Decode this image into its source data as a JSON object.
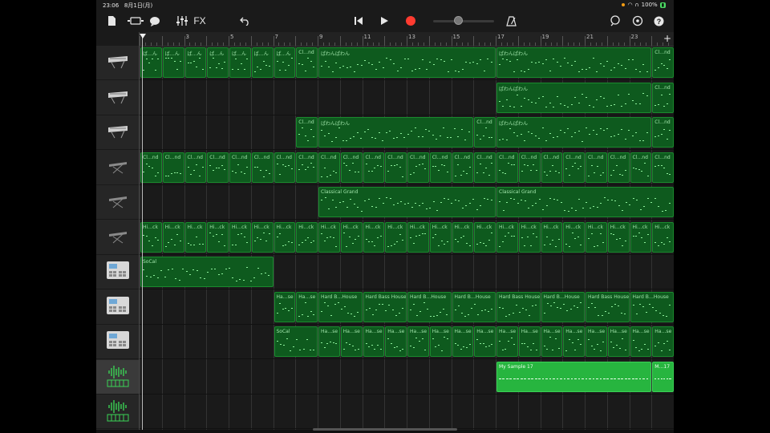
{
  "status": {
    "time": "23:06",
    "date": "8月1日(月)",
    "battery": "100%"
  },
  "toolbar": {
    "fx_label": "FX",
    "add_label": "+"
  },
  "colors": {
    "midi_region": "#0e5a1e",
    "audio_region": "#27b53f",
    "record": "#ff3b30"
  },
  "ruler": {
    "bars": [
      "3",
      "5",
      "7",
      "9",
      "11",
      "13",
      "15",
      "17",
      "19",
      "21",
      "23"
    ]
  },
  "tracks": [
    {
      "icon": "synth-keyboard-icon",
      "selected": false
    },
    {
      "icon": "synth-keyboard-icon",
      "selected": false
    },
    {
      "icon": "synth-keyboard-icon",
      "selected": false
    },
    {
      "icon": "keyboard-stand-icon",
      "selected": false
    },
    {
      "icon": "keyboard-stand-icon",
      "selected": false
    },
    {
      "icon": "keyboard-stand-icon",
      "selected": false
    },
    {
      "icon": "drum-machine-icon",
      "selected": false
    },
    {
      "icon": "drum-machine-icon",
      "selected": false
    },
    {
      "icon": "drum-machine-icon",
      "selected": false
    },
    {
      "icon": "audio-recorder-icon",
      "selected": true
    },
    {
      "icon": "audio-recorder-icon",
      "selected": false
    }
  ],
  "regions": [
    {
      "track": 0,
      "start": 1,
      "len": 1,
      "label": "ば…ん"
    },
    {
      "track": 0,
      "start": 2,
      "len": 1,
      "label": "ば…ん"
    },
    {
      "track": 0,
      "start": 3,
      "len": 1,
      "label": "ば…ん"
    },
    {
      "track": 0,
      "start": 4,
      "len": 1,
      "label": "ば…ん"
    },
    {
      "track": 0,
      "start": 5,
      "len": 1,
      "label": "ば…ん"
    },
    {
      "track": 0,
      "start": 6,
      "len": 1,
      "label": "ば…ん"
    },
    {
      "track": 0,
      "start": 7,
      "len": 1,
      "label": "ば…ん"
    },
    {
      "track": 0,
      "start": 8,
      "len": 1,
      "label": "Cl…nd"
    },
    {
      "track": 0,
      "start": 9,
      "len": 8,
      "label": "ぱわんぱわん"
    },
    {
      "track": 0,
      "start": 17,
      "len": 7,
      "label": "ぱわんぱわん"
    },
    {
      "track": 0,
      "start": 24,
      "len": 1,
      "label": "Cl…nd"
    },
    {
      "track": 1,
      "start": 17,
      "len": 7,
      "label": "ぱわんぱわん"
    },
    {
      "track": 1,
      "start": 24,
      "len": 1,
      "label": "Cl…nd"
    },
    {
      "track": 2,
      "start": 8,
      "len": 1,
      "label": "Cl…nd"
    },
    {
      "track": 2,
      "start": 9,
      "len": 7,
      "label": "ぱわんぱわん"
    },
    {
      "track": 2,
      "start": 16,
      "len": 1,
      "label": "Cl…nd"
    },
    {
      "track": 2,
      "start": 17,
      "len": 7,
      "label": "ぱわんぱわん"
    },
    {
      "track": 2,
      "start": 24,
      "len": 1,
      "label": "Cl…nd"
    },
    {
      "track": 3,
      "start": 1,
      "len": 1,
      "label": "Cl…nd"
    },
    {
      "track": 3,
      "start": 2,
      "len": 1,
      "label": "Cl…nd"
    },
    {
      "track": 3,
      "start": 3,
      "len": 1,
      "label": "Cl…nd"
    },
    {
      "track": 3,
      "start": 4,
      "len": 1,
      "label": "Cl…nd"
    },
    {
      "track": 3,
      "start": 5,
      "len": 1,
      "label": "Cl…nd"
    },
    {
      "track": 3,
      "start": 6,
      "len": 1,
      "label": "Cl…nd"
    },
    {
      "track": 3,
      "start": 7,
      "len": 1,
      "label": "Cl…nd"
    },
    {
      "track": 3,
      "start": 8,
      "len": 1,
      "label": "Cl…nd"
    },
    {
      "track": 3,
      "start": 9,
      "len": 1,
      "label": "Cl…nd"
    },
    {
      "track": 3,
      "start": 10,
      "len": 1,
      "label": "Cl…nd"
    },
    {
      "track": 3,
      "start": 11,
      "len": 1,
      "label": "Cl…nd"
    },
    {
      "track": 3,
      "start": 12,
      "len": 1,
      "label": "Cl…nd"
    },
    {
      "track": 3,
      "start": 13,
      "len": 1,
      "label": "Cl…nd"
    },
    {
      "track": 3,
      "start": 14,
      "len": 1,
      "label": "Cl…nd"
    },
    {
      "track": 3,
      "start": 15,
      "len": 1,
      "label": "Cl…nd"
    },
    {
      "track": 3,
      "start": 16,
      "len": 1,
      "label": "Cl…nd"
    },
    {
      "track": 3,
      "start": 17,
      "len": 1,
      "label": "Cl…nd"
    },
    {
      "track": 3,
      "start": 18,
      "len": 1,
      "label": "Cl…nd"
    },
    {
      "track": 3,
      "start": 19,
      "len": 1,
      "label": "Cl…nd"
    },
    {
      "track": 3,
      "start": 20,
      "len": 1,
      "label": "Cl…nd"
    },
    {
      "track": 3,
      "start": 21,
      "len": 1,
      "label": "Cl…nd"
    },
    {
      "track": 3,
      "start": 22,
      "len": 1,
      "label": "Cl…nd"
    },
    {
      "track": 3,
      "start": 23,
      "len": 1,
      "label": "Cl…nd"
    },
    {
      "track": 3,
      "start": 24,
      "len": 1,
      "label": "Cl…nd"
    },
    {
      "track": 4,
      "start": 9,
      "len": 8,
      "label": "Classical Grand"
    },
    {
      "track": 4,
      "start": 17,
      "len": 8,
      "label": "Classical Grand"
    },
    {
      "track": 5,
      "start": 1,
      "len": 1,
      "label": "Hi…ck"
    },
    {
      "track": 5,
      "start": 2,
      "len": 1,
      "label": "Hi…ck"
    },
    {
      "track": 5,
      "start": 3,
      "len": 1,
      "label": "Hi…ck"
    },
    {
      "track": 5,
      "start": 4,
      "len": 1,
      "label": "Hi…ck"
    },
    {
      "track": 5,
      "start": 5,
      "len": 1,
      "label": "Hi…ck"
    },
    {
      "track": 5,
      "start": 6,
      "len": 1,
      "label": "Hi…ck"
    },
    {
      "track": 5,
      "start": 7,
      "len": 1,
      "label": "Hi…ck"
    },
    {
      "track": 5,
      "start": 8,
      "len": 1,
      "label": "Hi…ck"
    },
    {
      "track": 5,
      "start": 9,
      "len": 1,
      "label": "Hi…ck"
    },
    {
      "track": 5,
      "start": 10,
      "len": 1,
      "label": "Hi…ck"
    },
    {
      "track": 5,
      "start": 11,
      "len": 1,
      "label": "Hi…ck"
    },
    {
      "track": 5,
      "start": 12,
      "len": 1,
      "label": "Hi…ck"
    },
    {
      "track": 5,
      "start": 13,
      "len": 1,
      "label": "Hi…ck"
    },
    {
      "track": 5,
      "start": 14,
      "len": 1,
      "label": "Hi…ck"
    },
    {
      "track": 5,
      "start": 15,
      "len": 1,
      "label": "Hi…ck"
    },
    {
      "track": 5,
      "start": 16,
      "len": 1,
      "label": "Hi…ck"
    },
    {
      "track": 5,
      "start": 17,
      "len": 1,
      "label": "Hi…ck"
    },
    {
      "track": 5,
      "start": 18,
      "len": 1,
      "label": "Hi…ck"
    },
    {
      "track": 5,
      "start": 19,
      "len": 1,
      "label": "Hi…ck"
    },
    {
      "track": 5,
      "start": 20,
      "len": 1,
      "label": "Hi…ck"
    },
    {
      "track": 5,
      "start": 21,
      "len": 1,
      "label": "Hi…ck"
    },
    {
      "track": 5,
      "start": 22,
      "len": 1,
      "label": "Hi…ck"
    },
    {
      "track": 5,
      "start": 23,
      "len": 1,
      "label": "Hi…ck"
    },
    {
      "track": 5,
      "start": 24,
      "len": 1,
      "label": "Hi…ck"
    },
    {
      "track": 6,
      "start": 1,
      "len": 6,
      "label": "SoCal"
    },
    {
      "track": 7,
      "start": 7,
      "len": 1,
      "label": "Ha…se"
    },
    {
      "track": 7,
      "start": 8,
      "len": 1,
      "label": "Ha…se"
    },
    {
      "track": 7,
      "start": 9,
      "len": 2,
      "label": "Hard B…House"
    },
    {
      "track": 7,
      "start": 11,
      "len": 2,
      "label": "Hard Bass House"
    },
    {
      "track": 7,
      "start": 13,
      "len": 2,
      "label": "Hard B…House"
    },
    {
      "track": 7,
      "start": 15,
      "len": 2,
      "label": "Hard B…House"
    },
    {
      "track": 7,
      "start": 17,
      "len": 2,
      "label": "Hard Bass House"
    },
    {
      "track": 7,
      "start": 19,
      "len": 2,
      "label": "Hard B…House"
    },
    {
      "track": 7,
      "start": 21,
      "len": 2,
      "label": "Hard Bass House"
    },
    {
      "track": 7,
      "start": 23,
      "len": 2,
      "label": "Hard B…House"
    },
    {
      "track": 8,
      "start": 7,
      "len": 2,
      "label": "SoCal"
    },
    {
      "track": 8,
      "start": 9,
      "len": 1,
      "label": "Ha…se"
    },
    {
      "track": 8,
      "start": 10,
      "len": 1,
      "label": "Ha…se"
    },
    {
      "track": 8,
      "start": 11,
      "len": 1,
      "label": "Ha…se"
    },
    {
      "track": 8,
      "start": 12,
      "len": 1,
      "label": "Ha…se"
    },
    {
      "track": 8,
      "start": 13,
      "len": 1,
      "label": "Ha…se"
    },
    {
      "track": 8,
      "start": 14,
      "len": 1,
      "label": "Ha…se"
    },
    {
      "track": 8,
      "start": 15,
      "len": 1,
      "label": "Ha…se"
    },
    {
      "track": 8,
      "start": 16,
      "len": 1,
      "label": "Ha…se"
    },
    {
      "track": 8,
      "start": 17,
      "len": 1,
      "label": "Ha…se"
    },
    {
      "track": 8,
      "start": 18,
      "len": 1,
      "label": "Ha…se"
    },
    {
      "track": 8,
      "start": 19,
      "len": 1,
      "label": "Ha…se"
    },
    {
      "track": 8,
      "start": 20,
      "len": 1,
      "label": "Ha…se"
    },
    {
      "track": 8,
      "start": 21,
      "len": 1,
      "label": "Ha…se"
    },
    {
      "track": 8,
      "start": 22,
      "len": 1,
      "label": "Ha…se"
    },
    {
      "track": 8,
      "start": 23,
      "len": 1,
      "label": "Ha…se"
    },
    {
      "track": 8,
      "start": 24,
      "len": 1,
      "label": "Ha…se"
    },
    {
      "track": 9,
      "start": 17,
      "len": 7,
      "label": "My Sample 17",
      "audio": true
    },
    {
      "track": 9,
      "start": 24,
      "len": 1,
      "label": "M…17",
      "audio": true
    }
  ]
}
